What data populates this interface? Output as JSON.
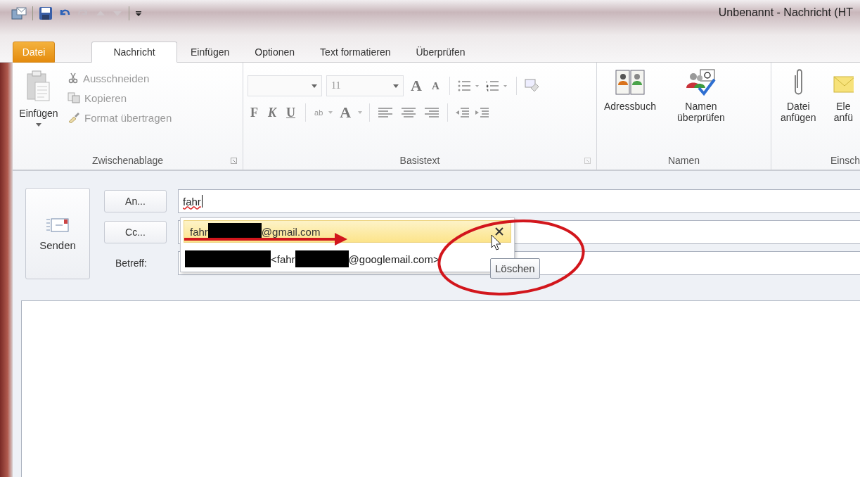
{
  "window": {
    "title": "Unbenannt - Nachricht (HT"
  },
  "tabs": [
    {
      "label": "Datei",
      "kind": "file",
      "selected": false
    },
    {
      "label": "Nachricht",
      "kind": "tab",
      "selected": true
    },
    {
      "label": "Einfügen",
      "kind": "tab",
      "selected": false
    },
    {
      "label": "Optionen",
      "kind": "tab",
      "selected": false
    },
    {
      "label": "Text formatieren",
      "kind": "tab",
      "selected": false
    },
    {
      "label": "Überprüfen",
      "kind": "tab",
      "selected": false
    }
  ],
  "clipboard": {
    "label": "Zwischenablage",
    "paste": {
      "label": "Einfügen"
    },
    "items": [
      {
        "label": "Ausschneiden",
        "disabled": true
      },
      {
        "label": "Kopieren",
        "disabled": true
      },
      {
        "label": "Format übertragen",
        "disabled": true
      }
    ]
  },
  "basic_text": {
    "label": "Basistext",
    "font_size": "11",
    "grow_shrink": [
      "A",
      "A"
    ],
    "styles": [
      "F",
      "K",
      "U"
    ],
    "highlight": "ab",
    "font_color": "A",
    "disabled": true
  },
  "names": {
    "label": "Namen",
    "buttons": [
      {
        "label": "Adressbuch"
      },
      {
        "label": "Namen überprüfen"
      }
    ]
  },
  "include": {
    "label": "Einsch",
    "buttons": [
      {
        "label": "Datei anfügen"
      },
      {
        "label": "Ele anfü"
      }
    ]
  },
  "header": {
    "send": {
      "label": "Senden"
    },
    "to": {
      "label": "An...",
      "value": "fahr"
    },
    "cc": {
      "label": "Cc..."
    },
    "subject": {
      "label": "Betreff:"
    }
  },
  "autocomplete": {
    "suggestions": [
      {
        "selected": true,
        "parts": [
          {
            "kind": "text",
            "text": "fahr"
          },
          {
            "kind": "redacted"
          },
          {
            "kind": "text",
            "text": "@gmail.com"
          }
        ]
      },
      {
        "selected": false,
        "parts": [
          {
            "kind": "redacted"
          },
          {
            "kind": "text",
            "text": "<fahr"
          },
          {
            "kind": "redacted"
          },
          {
            "kind": "text",
            "text": "@googlemail.com>"
          }
        ]
      }
    ],
    "tooltip": "Löschen"
  }
}
